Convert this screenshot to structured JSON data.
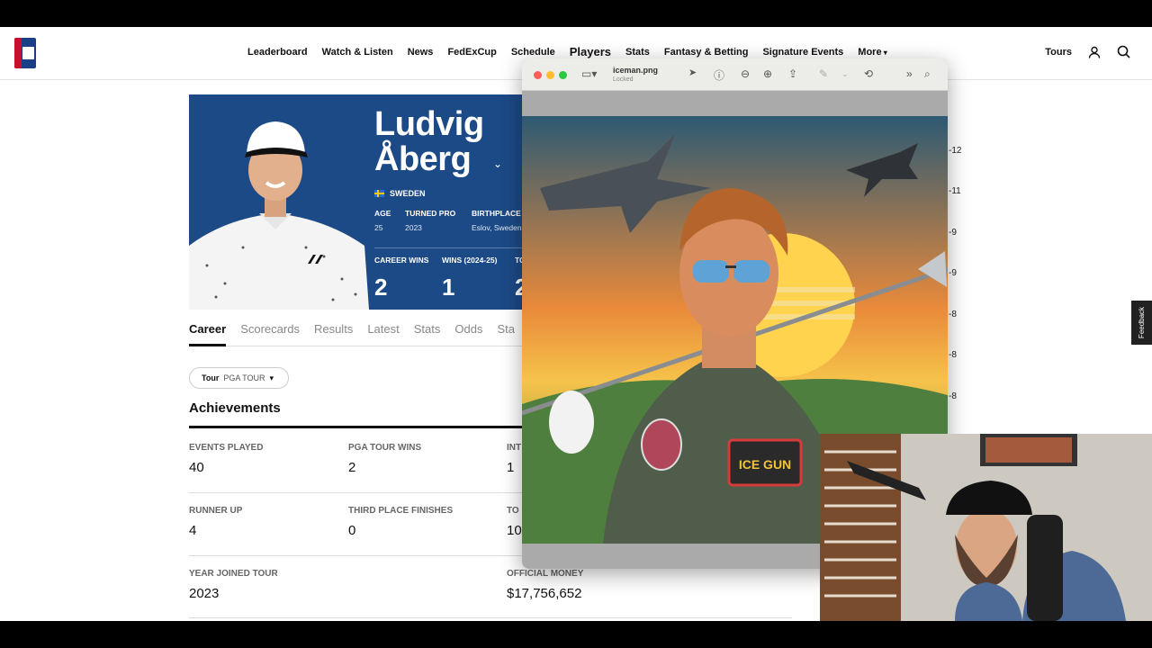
{
  "nav": {
    "links": [
      "Leaderboard",
      "Watch & Listen",
      "News",
      "FedExCup",
      "Schedule",
      "Players",
      "Stats",
      "Fantasy & Betting",
      "Signature Events",
      "More"
    ],
    "tours_label": "Tours"
  },
  "player": {
    "first_name": "Ludvig",
    "last_name": "Åberg",
    "country": "SWEDEN",
    "stats_small": [
      {
        "label": "AGE",
        "value": "25"
      },
      {
        "label": "TURNED PRO",
        "value": "2023"
      },
      {
        "label": "BIRTHPLACE",
        "value": "Eslov, Sweden"
      }
    ],
    "stats_big": [
      {
        "label": "CAREER WINS",
        "value": "2"
      },
      {
        "label": "WINS (2024-25)",
        "value": "1"
      },
      {
        "label": "TO",
        "value": "2"
      }
    ]
  },
  "tabs": [
    "Career",
    "Scorecards",
    "Results",
    "Latest",
    "Stats",
    "Odds",
    "Sta"
  ],
  "tour_select": {
    "key": "Tour",
    "value": "PGA TOUR"
  },
  "achievements": {
    "title": "Achievements",
    "rows": [
      [
        {
          "label": "EVENTS PLAYED",
          "value": "40"
        },
        {
          "label": "PGA TOUR WINS",
          "value": "2"
        },
        {
          "label": "INT",
          "value": "1"
        }
      ],
      [
        {
          "label": "RUNNER UP",
          "value": "4"
        },
        {
          "label": "THIRD PLACE FINISHES",
          "value": "0"
        },
        {
          "label": "TO",
          "value": "10"
        }
      ],
      [
        {
          "label": "YEAR JOINED TOUR",
          "value": "2023"
        },
        {
          "label": "",
          "value": ""
        },
        {
          "label": "OFFICIAL MONEY",
          "value": "$17,756,652"
        }
      ]
    ]
  },
  "preview": {
    "filename": "iceman.png",
    "status": "Locked",
    "patch_text": "ICE GUN"
  },
  "right_ticks": [
    "-12",
    "-11",
    "-9",
    "-9",
    "-8",
    "-8",
    "-8"
  ],
  "feedback_label": "Feedback",
  "colors": {
    "hero_bg": "#1c4a86",
    "brand_red": "#c8102e"
  }
}
